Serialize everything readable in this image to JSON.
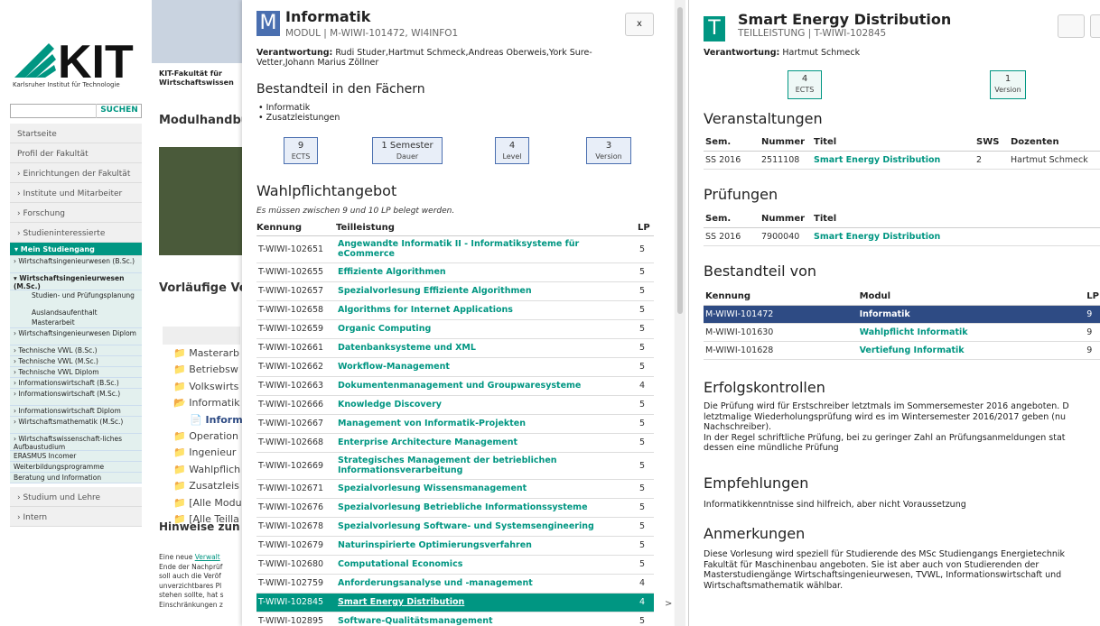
{
  "left": {
    "logo_sub": "Karlsruher Institut für Technologie",
    "faculty": "KIT-Fakultät für Wirtschaftswissen",
    "search_btn": "SUCHEN",
    "nav": [
      "Startseite",
      "Profil der Fakultät",
      "› Einrichtungen der Fakultät",
      "› Institute und Mitarbeiter",
      "› Forschung",
      "› Studieninteressierte"
    ],
    "mein": "▾ Mein Studiengang",
    "sub": [
      "› Wirtschaftsingenieurwesen (B.Sc.)",
      "▾ Wirtschaftsingenieurwesen (M.Sc.)"
    ],
    "deep": [
      "Studien- und Prüfungsplanung",
      "Auslandsaufenthalt",
      "Masterarbeit"
    ],
    "sub2": [
      "› Wirtschaftsingenieurwesen Diplom",
      "› Technische VWL (B.Sc.)",
      "› Technische VWL (M.Sc.)",
      "› Technische VWL Diplom",
      "› Informationswirtschaft (B.Sc.)",
      "› Informationswirtschaft (M.Sc.)",
      "› Informationswirtschaft Diplom",
      "› Wirtschaftsmathematik (M.Sc.)",
      "› Wirtschaftswissenschaft-liches Aufbaustudium",
      "ERASMUS Incomer",
      "Weiterbildungsprogramme",
      "Beratung und Information"
    ],
    "nav2": [
      "› Studium und Lehre",
      "› Intern"
    ],
    "main_heading": "Modulhandbu",
    "vor_heading": "Vorläufige Ve",
    "tree": [
      "Masterarb",
      "Betriebsw",
      "Volkswirts",
      "Informatik",
      "Inform",
      "Operation",
      "Ingenieur",
      "Wahlpflich",
      "Zusatzleis",
      "[Alle Modu",
      "[Alle Teilla"
    ],
    "hinweise": "Hinweise zun",
    "body": [
      "Eine neue ",
      "Verwalt",
      "Ende der Nachprüf",
      "soll auch die Veröf",
      "unverzichtbares Pl",
      "stehen sollte, hat s",
      "Einschränkungen z"
    ]
  },
  "p1": {
    "badge": "M",
    "title": "Informatik",
    "sub": "MODUL | M-WIWI-101472, WI4INFO1",
    "close": "x",
    "verant_label": "Verantwortung:",
    "verant": "Rudi Studer,Hartmut Schmeck,Andreas Oberweis,York Sure-Vetter,Johann Marius Zöllner",
    "bestandteil": "Bestandteil in den Fächern",
    "faecher": [
      "Informatik",
      "Zusatzleistungen"
    ],
    "boxes": [
      {
        "v": "9",
        "l": "ECTS"
      },
      {
        "v": "1 Semester",
        "l": "Dauer"
      },
      {
        "v": "4",
        "l": "Level"
      },
      {
        "v": "3",
        "l": "Version"
      }
    ],
    "wahl": "Wahlpflichtangebot",
    "note": "Es müssen zwischen 9 und 10 LP belegt werden.",
    "cols": [
      "Kennung",
      "Teilleistung",
      "LP"
    ],
    "rows": [
      [
        "T-WIWI-102651",
        "Angewandte Informatik II - Informatiksysteme für eCommerce",
        "5"
      ],
      [
        "T-WIWI-102655",
        "Effiziente Algorithmen",
        "5"
      ],
      [
        "T-WIWI-102657",
        "Spezialvorlesung Effiziente Algorithmen",
        "5"
      ],
      [
        "T-WIWI-102658",
        "Algorithms for Internet Applications",
        "5"
      ],
      [
        "T-WIWI-102659",
        "Organic Computing",
        "5"
      ],
      [
        "T-WIWI-102661",
        "Datenbanksysteme und XML",
        "5"
      ],
      [
        "T-WIWI-102662",
        "Workflow-Management",
        "5"
      ],
      [
        "T-WIWI-102663",
        "Dokumentenmanagement und Groupwaresysteme",
        "4"
      ],
      [
        "T-WIWI-102666",
        "Knowledge Discovery",
        "5"
      ],
      [
        "T-WIWI-102667",
        "Management von Informatik-Projekten",
        "5"
      ],
      [
        "T-WIWI-102668",
        "Enterprise Architecture Management",
        "5"
      ],
      [
        "T-WIWI-102669",
        "Strategisches Management der betrieblichen Informationsverarbeitung",
        "5"
      ],
      [
        "T-WIWI-102671",
        "Spezialvorlesung Wissensmanagement",
        "5"
      ],
      [
        "T-WIWI-102676",
        "Spezialvorlesung Betriebliche Informationssysteme",
        "5"
      ],
      [
        "T-WIWI-102678",
        "Spezialvorlesung Software- und Systemsengineering",
        "5"
      ],
      [
        "T-WIWI-102679",
        "Naturinspirierte Optimierungsverfahren",
        "5"
      ],
      [
        "T-WIWI-102680",
        "Computational Economics",
        "5"
      ],
      [
        "T-WIWI-102759",
        "Anforderungsanalyse und -management",
        "4"
      ],
      [
        "T-WIWI-102845",
        "Smart Energy Distribution",
        "4"
      ],
      [
        "T-WIWI-102895",
        "Software-Qualitätsmanagement",
        "5"
      ]
    ]
  },
  "p2": {
    "badge": "T",
    "title": "Smart Energy Distribution",
    "sub": "TEILLEISTUNG | T-WIWI-102845",
    "verant_label": "Verantwortung:",
    "verant": "Hartmut Schmeck",
    "boxes": [
      {
        "v": "4",
        "l": "ECTS"
      },
      {
        "v": "1",
        "l": "Version"
      }
    ],
    "veranst": "Veranstaltungen",
    "vcols": [
      "Sem.",
      "Nummer",
      "Titel",
      "SWS",
      "Dozenten"
    ],
    "vrow": [
      "SS 2016",
      "2511108",
      "Smart Energy Distribution",
      "2",
      "Hartmut Schmeck"
    ],
    "pruef": "Prüfungen",
    "pcols": [
      "Sem.",
      "Nummer",
      "Titel"
    ],
    "prow": [
      "SS 2016",
      "7900040",
      "Smart Energy Distribution"
    ],
    "bestv": "Bestandteil von",
    "bcols": [
      "Kennung",
      "Modul",
      "LP"
    ],
    "brows": [
      [
        "M-WIWI-101472",
        "Informatik",
        "9"
      ],
      [
        "M-WIWI-101630",
        "Wahlpflicht Informatik",
        "9"
      ],
      [
        "M-WIWI-101628",
        "Vertiefung Informatik",
        "9"
      ]
    ],
    "erfolg": "Erfolgskontrollen",
    "erfolg_text": [
      "Die Prüfung wird für Erstschreiber letztmals im Sommersemester 2016 angeboten. D",
      "letztmalige Wiederholungsprüfung wird es im Wintersemester 2016/2017 geben (nu",
      "Nachschreiber).",
      "In der Regel schriftliche Prüfung, bei zu geringer Zahl an Prüfungsanmeldungen stat",
      "dessen eine mündliche Prüfung"
    ],
    "empf": "Empfehlungen",
    "empf_text": "Informatikkenntnisse sind hilfreich, aber nicht Voraussetzung",
    "anm": "Anmerkungen",
    "anm_text": [
      "Diese Vorlesung wird speziell für Studierende des MSc Studiengangs Energietechnik",
      "Fakultät für Maschinenbau angeboten. Sie ist aber auch von Studierenden der",
      "Masterstudiengänge Wirtschaftsingenieurwesen, TVWL, Informationswirtschaft und",
      "Wirtschaftsmathematik wählbar."
    ]
  }
}
